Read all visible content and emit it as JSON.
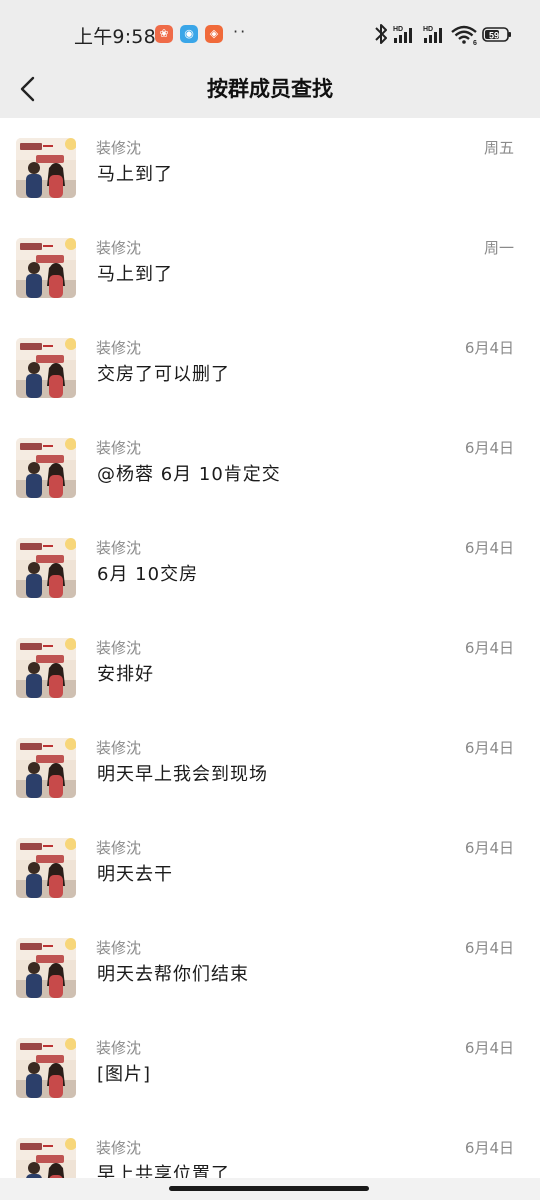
{
  "status_bar": {
    "time": "上午9:58",
    "more_dots": "··",
    "battery": "59",
    "network_badge": "HD",
    "wifi_badge": "6"
  },
  "header": {
    "title": "按群成员查找"
  },
  "colors": {
    "bar_bg": "#ededed",
    "text_primary": "#1b1b1b",
    "text_secondary": "#8a8a8a"
  },
  "messages": [
    {
      "sender": "装修沈",
      "text": "马上到了",
      "date": "周五"
    },
    {
      "sender": "装修沈",
      "text": "马上到了",
      "date": "周一"
    },
    {
      "sender": "装修沈",
      "text": "交房了可以删了",
      "date": "6月4日"
    },
    {
      "sender": "装修沈",
      "text": "@杨蓉 6月 10肯定交",
      "date": "6月4日"
    },
    {
      "sender": "装修沈",
      "text": "6月 10交房",
      "date": "6月4日"
    },
    {
      "sender": "装修沈",
      "text": "安排好",
      "date": "6月4日"
    },
    {
      "sender": "装修沈",
      "text": "明天早上我会到现场",
      "date": "6月4日"
    },
    {
      "sender": "装修沈",
      "text": "明天去干",
      "date": "6月4日"
    },
    {
      "sender": "装修沈",
      "text": "明天去帮你们结束",
      "date": "6月4日"
    },
    {
      "sender": "装修沈",
      "text": "[图片]",
      "date": "6月4日"
    },
    {
      "sender": "装修沈",
      "text": "早上共享位置了",
      "date": "6月4日"
    }
  ]
}
